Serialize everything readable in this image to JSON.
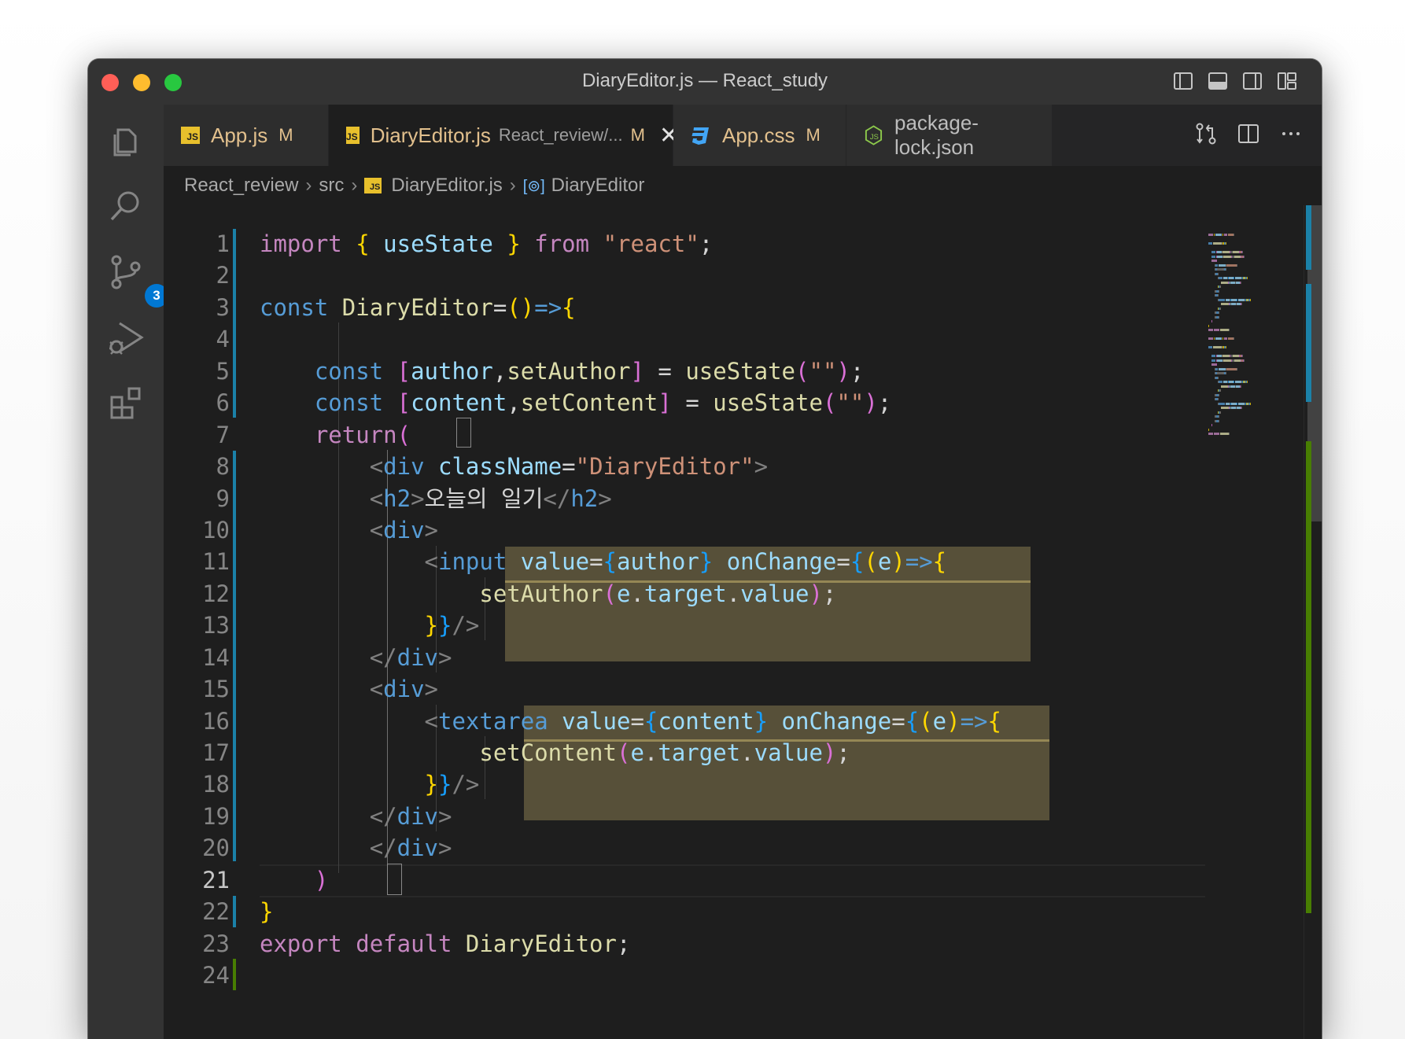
{
  "window": {
    "title": "DiaryEditor.js — React_study"
  },
  "activity": {
    "scm_badge": "3"
  },
  "tabs": [
    {
      "name": "App.js",
      "status": "M",
      "icon": "js-icon"
    },
    {
      "name": "DiaryEditor.js",
      "description": "React_review/...",
      "status": "M",
      "icon": "js-icon",
      "active": true
    },
    {
      "name": "App.css",
      "status": "M",
      "icon": "css-icon"
    },
    {
      "name": "package-lock.json",
      "icon": "nodejs-icon"
    }
  ],
  "breadcrumb": {
    "items": [
      "React_review",
      "src",
      "DiaryEditor.js",
      "DiaryEditor"
    ]
  },
  "editor": {
    "current_line": "21",
    "line_numbers": [
      "1",
      "2",
      "3",
      "4",
      "5",
      "6",
      "7",
      "8",
      "9",
      "10",
      "11",
      "12",
      "13",
      "14",
      "15",
      "16",
      "17",
      "18",
      "19",
      "20",
      "21",
      "22",
      "23",
      "24"
    ]
  },
  "colors": {
    "accent": "#0078d4",
    "modified": "#e2c08d",
    "added_gutter": "#487e02",
    "changed_gutter": "#1b81a8",
    "bracket_highlight": "#c8b46e"
  },
  "code": [
    [
      [
        "kw2",
        "import"
      ],
      [
        "t",
        " "
      ],
      [
        "brY",
        "{"
      ],
      [
        "t",
        " "
      ],
      [
        "var",
        "useState"
      ],
      [
        "t",
        " "
      ],
      [
        "brY",
        "}"
      ],
      [
        "t",
        " "
      ],
      [
        "kw2",
        "from"
      ],
      [
        "t",
        " "
      ],
      [
        "str",
        "\"react\""
      ],
      [
        "t",
        ";"
      ]
    ],
    [],
    [
      [
        "kw",
        "const"
      ],
      [
        "t",
        " "
      ],
      [
        "fn",
        "DiaryEditor"
      ],
      [
        "t",
        "="
      ],
      [
        "brY",
        "()"
      ],
      [
        "kw",
        "=>"
      ],
      [
        "brY",
        "{"
      ]
    ],
    [],
    [
      [
        "t",
        "    "
      ],
      [
        "kw",
        "const"
      ],
      [
        "t",
        " "
      ],
      [
        "brP",
        "["
      ],
      [
        "var",
        "author"
      ],
      [
        "t",
        ","
      ],
      [
        "fn",
        "setAuthor"
      ],
      [
        "brP",
        "]"
      ],
      [
        "t",
        " = "
      ],
      [
        "fn",
        "useState"
      ],
      [
        "brP",
        "("
      ],
      [
        "str",
        "\"\""
      ],
      [
        "brP",
        ")"
      ],
      [
        "t",
        ";"
      ]
    ],
    [
      [
        "t",
        "    "
      ],
      [
        "kw",
        "const"
      ],
      [
        "t",
        " "
      ],
      [
        "brP",
        "["
      ],
      [
        "var",
        "content"
      ],
      [
        "t",
        ","
      ],
      [
        "fn",
        "setContent"
      ],
      [
        "brP",
        "]"
      ],
      [
        "t",
        " = "
      ],
      [
        "fn",
        "useState"
      ],
      [
        "brP",
        "("
      ],
      [
        "str",
        "\"\""
      ],
      [
        "brP",
        ")"
      ],
      [
        "t",
        ";"
      ]
    ],
    [
      [
        "t",
        "    "
      ],
      [
        "ctl",
        "return"
      ],
      [
        "brP",
        "("
      ]
    ],
    [
      [
        "t",
        "        "
      ],
      [
        "pun",
        "<"
      ],
      [
        "tag",
        "div"
      ],
      [
        "t",
        " "
      ],
      [
        "attr",
        "className"
      ],
      [
        "t",
        "="
      ],
      [
        "str",
        "\"DiaryEditor\""
      ],
      [
        "pun",
        ">"
      ]
    ],
    [
      [
        "t",
        "        "
      ],
      [
        "pun",
        "<"
      ],
      [
        "tag",
        "h2"
      ],
      [
        "pun",
        ">"
      ],
      [
        "t",
        "오늘의 일기"
      ],
      [
        "pun",
        "</"
      ],
      [
        "tag",
        "h2"
      ],
      [
        "pun",
        ">"
      ]
    ],
    [
      [
        "t",
        "        "
      ],
      [
        "pun",
        "<"
      ],
      [
        "tag",
        "div"
      ],
      [
        "pun",
        ">"
      ]
    ],
    [
      [
        "t",
        "            "
      ],
      [
        "pun",
        "<"
      ],
      [
        "tag",
        "input"
      ],
      [
        "t",
        " "
      ],
      [
        "attr",
        "value"
      ],
      [
        "t",
        "="
      ],
      [
        "brB",
        "{"
      ],
      [
        "var",
        "author"
      ],
      [
        "brB",
        "}"
      ],
      [
        "t",
        " "
      ],
      [
        "attr",
        "onChange"
      ],
      [
        "t",
        "="
      ],
      [
        "brB",
        "{"
      ],
      [
        "brY",
        "("
      ],
      [
        "var",
        "e"
      ],
      [
        "brY",
        ")"
      ],
      [
        "kw",
        "=>"
      ],
      [
        "brY",
        "{"
      ]
    ],
    [
      [
        "t",
        "                "
      ],
      [
        "fn",
        "setAuthor"
      ],
      [
        "brP",
        "("
      ],
      [
        "var",
        "e"
      ],
      [
        "t",
        "."
      ],
      [
        "var",
        "target"
      ],
      [
        "t",
        "."
      ],
      [
        "var",
        "value"
      ],
      [
        "brP",
        ")"
      ],
      [
        "t",
        ";"
      ]
    ],
    [
      [
        "t",
        "            "
      ],
      [
        "brY",
        "}"
      ],
      [
        "brB",
        "}"
      ],
      [
        "pun",
        "/>"
      ]
    ],
    [
      [
        "t",
        "        "
      ],
      [
        "pun",
        "</"
      ],
      [
        "tag",
        "div"
      ],
      [
        "pun",
        ">"
      ]
    ],
    [
      [
        "t",
        "        "
      ],
      [
        "pun",
        "<"
      ],
      [
        "tag",
        "div"
      ],
      [
        "pun",
        ">"
      ]
    ],
    [
      [
        "t",
        "            "
      ],
      [
        "pun",
        "<"
      ],
      [
        "tag",
        "textarea"
      ],
      [
        "t",
        " "
      ],
      [
        "attr",
        "value"
      ],
      [
        "t",
        "="
      ],
      [
        "brB",
        "{"
      ],
      [
        "var",
        "content"
      ],
      [
        "brB",
        "}"
      ],
      [
        "t",
        " "
      ],
      [
        "attr",
        "onChange"
      ],
      [
        "t",
        "="
      ],
      [
        "brB",
        "{"
      ],
      [
        "brY",
        "("
      ],
      [
        "var",
        "e"
      ],
      [
        "brY",
        ")"
      ],
      [
        "kw",
        "=>"
      ],
      [
        "brY",
        "{"
      ]
    ],
    [
      [
        "t",
        "                "
      ],
      [
        "fn",
        "setContent"
      ],
      [
        "brP",
        "("
      ],
      [
        "var",
        "e"
      ],
      [
        "t",
        "."
      ],
      [
        "var",
        "target"
      ],
      [
        "t",
        "."
      ],
      [
        "var",
        "value"
      ],
      [
        "brP",
        ")"
      ],
      [
        "t",
        ";"
      ]
    ],
    [
      [
        "t",
        "            "
      ],
      [
        "brY",
        "}"
      ],
      [
        "brB",
        "}"
      ],
      [
        "pun",
        "/>"
      ]
    ],
    [
      [
        "t",
        "        "
      ],
      [
        "pun",
        "</"
      ],
      [
        "tag",
        "div"
      ],
      [
        "pun",
        ">"
      ]
    ],
    [
      [
        "t",
        "        "
      ],
      [
        "pun",
        "</"
      ],
      [
        "tag",
        "div"
      ],
      [
        "pun",
        ">"
      ]
    ],
    [
      [
        "t",
        "    "
      ],
      [
        "brP",
        ")"
      ]
    ],
    [
      [
        "brY",
        "}"
      ]
    ],
    [
      [
        "ctl",
        "export"
      ],
      [
        "t",
        " "
      ],
      [
        "ctl",
        "default"
      ],
      [
        "t",
        " "
      ],
      [
        "fn",
        "DiaryEditor"
      ],
      [
        "t",
        ";"
      ]
    ],
    []
  ]
}
